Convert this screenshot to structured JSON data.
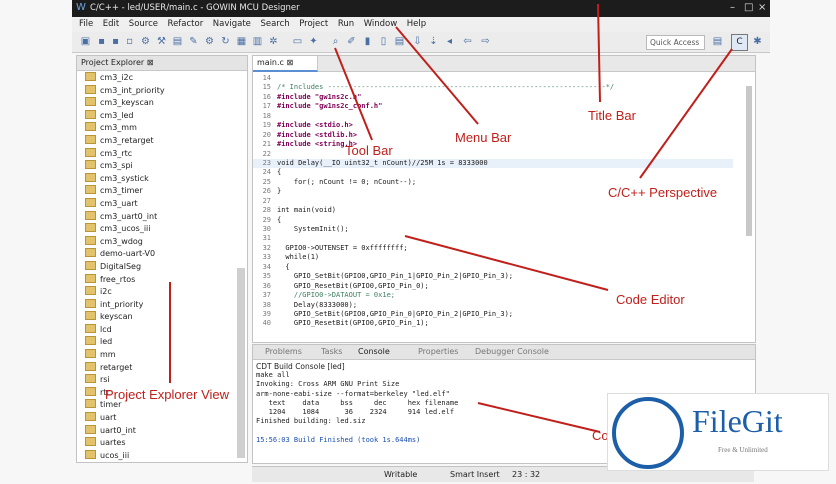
{
  "title": "C/C++ - led/USER/main.c - GOWIN MCU Designer",
  "menu": [
    "File",
    "Edit",
    "Source",
    "Refactor",
    "Navigate",
    "Search",
    "Project",
    "Run",
    "Window",
    "Help"
  ],
  "toolbar": {
    "quick_access": "Quick Access"
  },
  "project_explorer": {
    "title": "Project Explorer",
    "items": [
      "cm3_i2c",
      "cm3_int_priority",
      "cm3_keyscan",
      "cm3_led",
      "cm3_mm",
      "cm3_retarget",
      "cm3_rtc",
      "cm3_spi",
      "cm3_systick",
      "cm3_timer",
      "cm3_uart",
      "cm3_uart0_int",
      "cm3_ucos_iii",
      "cm3_wdog",
      "demo-uart-V0",
      "DigitalSeg",
      "free_rtos",
      "i2c",
      "int_priority",
      "keyscan",
      "lcd",
      "led",
      "mm",
      "retarget",
      "rsi",
      "rtc",
      "timer",
      "uart",
      "uart0_int",
      "uartes",
      "ucos_iii"
    ]
  },
  "editor": {
    "tab": "main.c",
    "lines": [
      {
        "n": "14",
        "t": ""
      },
      {
        "n": "15",
        "t": "/* Includes ------------------------------------------------------------------*/",
        "c": "cm"
      },
      {
        "n": "16",
        "t": "#include \"gw1ns2c.h\"",
        "c": "kw"
      },
      {
        "n": "17",
        "t": "#include \"gw1ns2c_conf.h\"",
        "c": "kw"
      },
      {
        "n": "18",
        "t": ""
      },
      {
        "n": "19",
        "t": "#include <stdio.h>",
        "c": "kw"
      },
      {
        "n": "20",
        "t": "#include <stdlib.h>",
        "c": "kw"
      },
      {
        "n": "21",
        "t": "#include <string.h>",
        "c": "kw"
      },
      {
        "n": "22",
        "t": ""
      },
      {
        "n": "23",
        "t": "void Delay(__IO uint32_t nCount)//25M 1s = 8333000",
        "h": true
      },
      {
        "n": "24",
        "t": "{"
      },
      {
        "n": "25",
        "t": "    for(; nCount != 0; nCount--);"
      },
      {
        "n": "26",
        "t": "}"
      },
      {
        "n": "27",
        "t": ""
      },
      {
        "n": "28",
        "t": "int main(void)"
      },
      {
        "n": "29",
        "t": "{"
      },
      {
        "n": "30",
        "t": "    SystemInit();"
      },
      {
        "n": "31",
        "t": ""
      },
      {
        "n": "32",
        "t": "  GPIO0->OUTENSET = 0xffffffff;"
      },
      {
        "n": "33",
        "t": "  while(1)"
      },
      {
        "n": "34",
        "t": "  {"
      },
      {
        "n": "35",
        "t": "    GPIO_SetBit(GPIO0,GPIO_Pin_1|GPIO_Pin_2|GPIO_Pin_3);"
      },
      {
        "n": "36",
        "t": "    GPIO_ResetBit(GPIO0,GPIO_Pin_0);"
      },
      {
        "n": "37",
        "t": "    //GPIO0->DATAOUT = 0x1e;",
        "c": "cm"
      },
      {
        "n": "38",
        "t": "    Delay(8333000);"
      },
      {
        "n": "39",
        "t": "    GPIO_SetBit(GPIO0,GPIO_Pin_0|GPIO_Pin_2|GPIO_Pin_3);"
      },
      {
        "n": "40",
        "t": "    GPIO_ResetBit(GPIO0,GPIO_Pin_1);"
      }
    ]
  },
  "console": {
    "tabs": [
      "Problems",
      "Tasks",
      "Console",
      "Properties",
      "Debugger Console"
    ],
    "header": "CDT Build Console [led]",
    "lines": [
      "make all",
      "Invoking: Cross ARM GNU Print Size",
      "arm-none-eabi-size --format=berkeley \"led.elf\"",
      "   text    data     bss     dec     hex filename",
      "   1204    1084      36    2324     914 led.elf",
      "Finished building: led.siz",
      ""
    ],
    "build_finished": "15:56:03 Build Finished (took 1s.644ms)"
  },
  "status": {
    "writable": "Writable",
    "insert": "Smart Insert",
    "pos": "23 : 32"
  },
  "annotations": {
    "title_bar": "Title Bar",
    "menu_bar": "Menu Bar",
    "tool_bar": "Tool Bar",
    "perspective": "C/C++ Perspective",
    "code_editor": "Code Editor",
    "project_explorer": "Project Explorer View",
    "console": "Co"
  },
  "watermark": {
    "name": "FileGit",
    "tagline": "Free & Unlimited"
  },
  "colors": {
    "annotation": "#c0201b",
    "brand": "#1c5fa8"
  }
}
